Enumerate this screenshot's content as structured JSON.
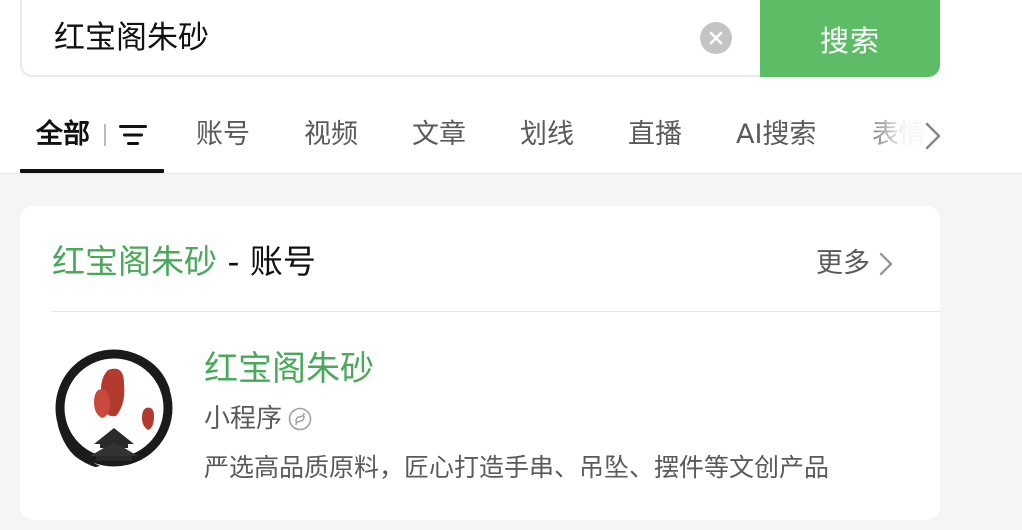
{
  "search": {
    "query": "红宝阁朱砂",
    "button_label": "搜索"
  },
  "tabs": [
    {
      "label": "全部",
      "active": true
    },
    {
      "label": "账号"
    },
    {
      "label": "视频"
    },
    {
      "label": "文章"
    },
    {
      "label": "划线"
    },
    {
      "label": "直播"
    },
    {
      "label": "AI搜索"
    },
    {
      "label": "表情"
    }
  ],
  "card": {
    "title_highlight": "红宝阁朱砂",
    "title_rest": " - 账号",
    "more_label": "更多",
    "result": {
      "name": "红宝阁朱砂",
      "type": "小程序",
      "description": "严选高品质原料，匠心打造手串、吊坠、摆件等文创产品"
    }
  },
  "colors": {
    "accent_green": "#5dbd66",
    "highlight_green": "#4aa85a"
  },
  "icons": [
    "clear-icon",
    "filter-icon",
    "chevron-right-icon",
    "mini-program-icon"
  ]
}
